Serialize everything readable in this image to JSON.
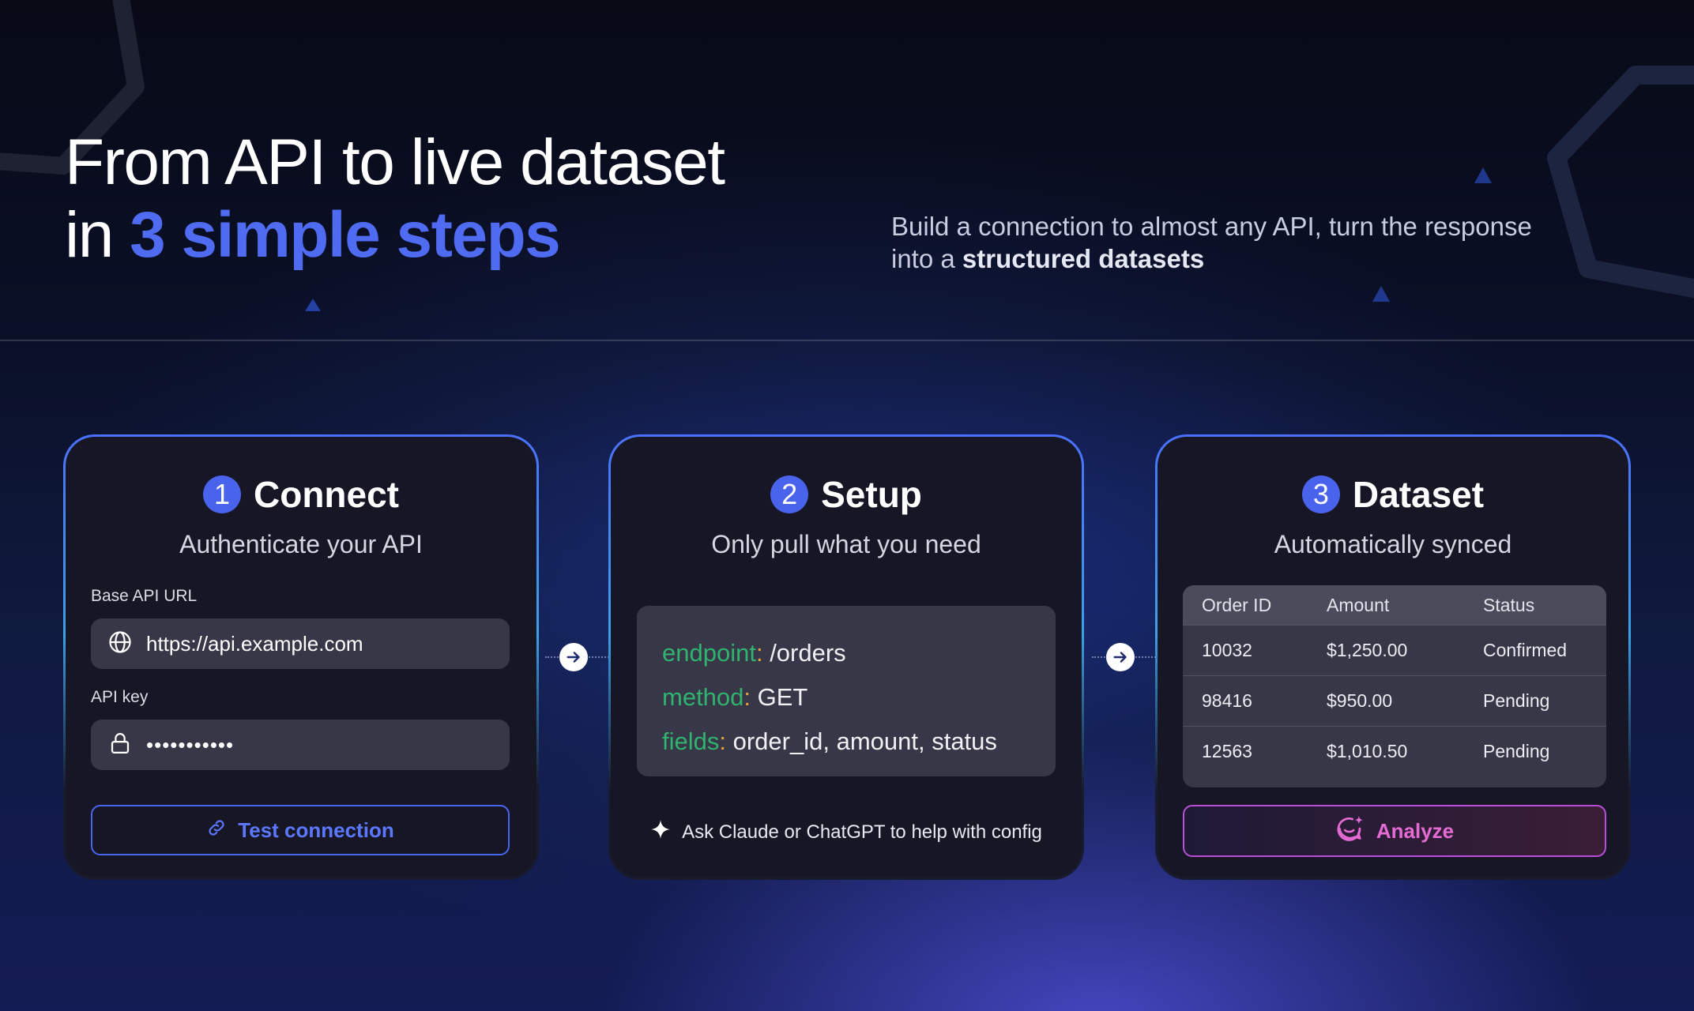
{
  "hero": {
    "title_line1": "From API to live dataset",
    "title_line2_prefix": "in ",
    "title_line2_accent": "3 simple steps",
    "subtitle_line1": "Build a connection to almost any API, turn the response",
    "subtitle_line2_prefix": "into a ",
    "subtitle_line2_bold": "structured datasets"
  },
  "colors": {
    "accent": "#4f6bf1",
    "code_key": "#2fb36f",
    "code_colon": "#e5a13a",
    "analyze": "#e56bd4"
  },
  "connect": {
    "number": "1",
    "title": "Connect",
    "subtitle": "Authenticate your API",
    "url_label": "Base API URL",
    "url_value": "https://api.example.com",
    "url_icon": "globe-icon",
    "key_label": "API key",
    "key_value": "•••••••••••",
    "key_icon": "lock-icon",
    "test_button": "Test connection",
    "test_icon": "link-icon"
  },
  "setup": {
    "number": "2",
    "title": "Setup",
    "subtitle": "Only pull what you need",
    "code": [
      {
        "key": "endpoint",
        "colon": ":",
        "value": " /orders"
      },
      {
        "key": "method",
        "colon": ":",
        "value": " GET"
      },
      {
        "key": "fields",
        "colon": ":",
        "value": " order_id, amount, status"
      }
    ],
    "ask_text": "Ask Claude or ChatGPT to help with config",
    "ask_icon": "sparkle-icon"
  },
  "dataset": {
    "number": "3",
    "title": "Dataset",
    "subtitle": "Automatically synced",
    "columns": [
      "Order ID",
      "Amount",
      "Status"
    ],
    "rows": [
      [
        "10032",
        "$1,250.00",
        "Confirmed"
      ],
      [
        "98416",
        "$950.00",
        "Pending"
      ],
      [
        "12563",
        "$1,010.50",
        "Pending"
      ]
    ],
    "analyze_button": "Analyze",
    "analyze_icon": "chat-sparkle-icon"
  }
}
